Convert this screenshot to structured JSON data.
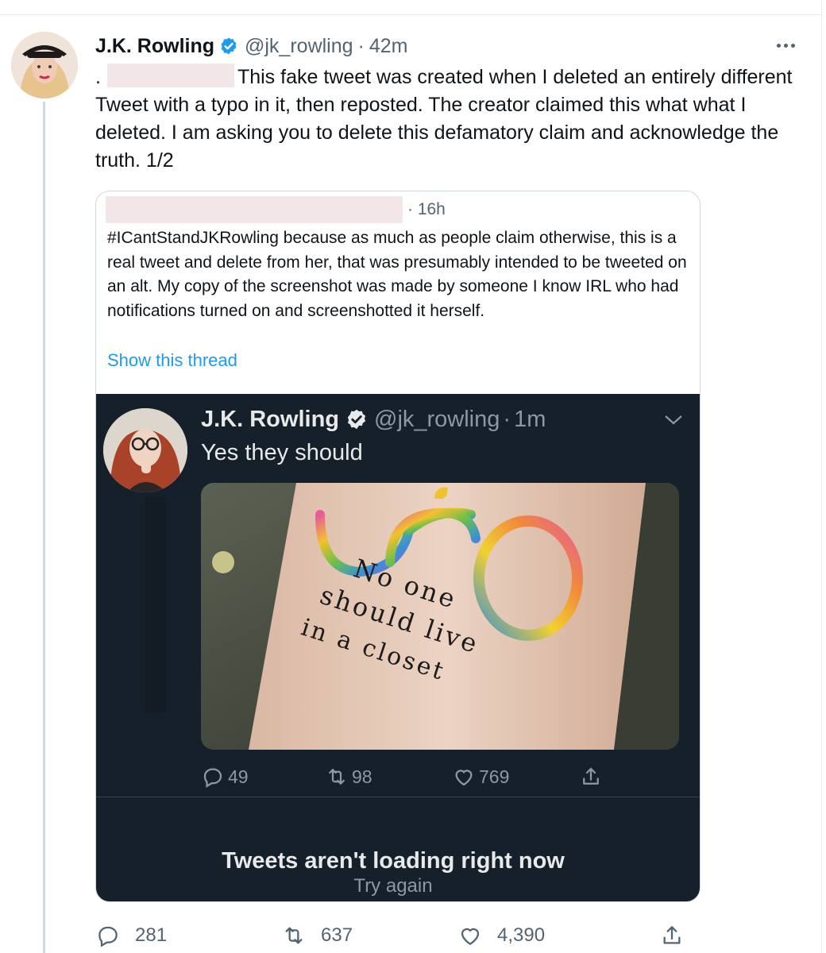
{
  "tweet": {
    "author_name": "J.K. Rowling",
    "handle": "@jk_rowling",
    "separator": "·",
    "time": "42m",
    "text_start": ".",
    "text": "This fake tweet was created when I deleted an entirely different Tweet with a typo in it, then reposted. The creator claimed this what what I deleted. I am asking you to delete this defamatory claim and acknowledge the truth. 1/2",
    "replies": "281",
    "retweets": "637",
    "likes": "4,390"
  },
  "quoted": {
    "time": "· 16h",
    "text": "#ICantStandJKRowling because as much as people claim otherwise, this is a real tweet and delete from her, that was presumably intended to be tweeted on an alt. My copy of the screenshot was made by someone I know IRL who had notifications turned on and screenshotted it herself.",
    "show_thread": "Show this thread"
  },
  "screenshot": {
    "author_name": "J.K. Rowling",
    "handle": "@jk_rowling",
    "separator": "·",
    "time": "1m",
    "text": "Yes they should",
    "tattoo_lines": [
      "No one",
      "should live",
      "in a closet"
    ],
    "replies": "49",
    "retweets": "98",
    "likes": "769",
    "error_title": "Tweets aren't loading right now",
    "retry": "Try again"
  },
  "colors": {
    "accent": "#1d9bf0",
    "dark_bg": "#15202b",
    "muted": "#536471"
  }
}
